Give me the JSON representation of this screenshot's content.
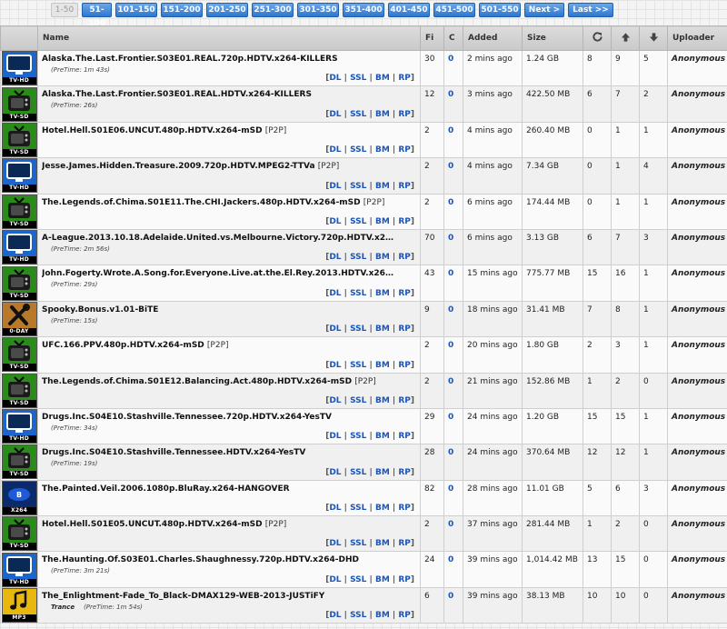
{
  "pager": {
    "current": "1-50",
    "links": [
      "51-100",
      "101-150",
      "151-200",
      "201-250",
      "251-300",
      "301-350",
      "351-400",
      "401-450",
      "451-500",
      "501-550"
    ],
    "next": "Next >",
    "last": "Last >>"
  },
  "columns": {
    "name": "Name",
    "files": "Fi",
    "comments": "C",
    "added": "Added",
    "size": "Size",
    "uploader": "Uploader"
  },
  "link_labels": {
    "dl": "DL",
    "ssl": "SSL",
    "bm": "BM",
    "rp": "RP"
  },
  "rows": [
    {
      "cat": "tvhd",
      "cat_label": "TV-HD",
      "name": "Alaska.The.Last.Frontier.S03E01.REAL.720p.HDTV.x264-KILLERS",
      "p2p": "",
      "pretime": "(PreTime: 1m 43s)",
      "genre": "",
      "files": "30",
      "comments": "0",
      "added": "2 mins ago",
      "size": "1.24 GB",
      "snatched": "8",
      "seeders": "9",
      "leechers": "5",
      "uploader": "Anonymous"
    },
    {
      "cat": "tvsd",
      "cat_label": "TV-SD",
      "name": "Alaska.The.Last.Frontier.S03E01.REAL.HDTV.x264-KILLERS",
      "p2p": "",
      "pretime": "(PreTime: 26s)",
      "genre": "",
      "files": "12",
      "comments": "0",
      "added": "3 mins ago",
      "size": "422.50 MB",
      "snatched": "6",
      "seeders": "7",
      "leechers": "2",
      "uploader": "Anonymous"
    },
    {
      "cat": "tvsd",
      "cat_label": "TV-SD",
      "name": "Hotel.Hell.S01E06.UNCUT.480p.HDTV.x264-mSD",
      "p2p": "[P2P]",
      "pretime": "",
      "genre": "",
      "files": "2",
      "comments": "0",
      "added": "4 mins ago",
      "size": "260.40 MB",
      "snatched": "0",
      "seeders": "1",
      "leechers": "1",
      "uploader": "Anonymous"
    },
    {
      "cat": "tvhd",
      "cat_label": "TV-HD",
      "name": "Jesse.James.Hidden.Treasure.2009.720p.HDTV.MPEG2-TTVa",
      "p2p": "[P2P]",
      "pretime": "",
      "genre": "",
      "files": "2",
      "comments": "0",
      "added": "4 mins ago",
      "size": "7.34 GB",
      "snatched": "0",
      "seeders": "1",
      "leechers": "4",
      "uploader": "Anonymous"
    },
    {
      "cat": "tvsd",
      "cat_label": "TV-SD",
      "name": "The.Legends.of.Chima.S01E11.The.CHI.Jackers.480p.HDTV.x264-mSD",
      "p2p": "[P2P]",
      "pretime": "",
      "genre": "",
      "files": "2",
      "comments": "0",
      "added": "6 mins ago",
      "size": "174.44 MB",
      "snatched": "0",
      "seeders": "1",
      "leechers": "1",
      "uploader": "Anonymous"
    },
    {
      "cat": "tvhd",
      "cat_label": "TV-HD",
      "name": "A-League.2013.10.18.Adelaide.United.vs.Melbourne.Victory.720p.HDTV.x264-...",
      "p2p": "",
      "pretime": "(PreTime: 2m 56s)",
      "genre": "",
      "files": "70",
      "comments": "0",
      "added": "6 mins ago",
      "size": "3.13 GB",
      "snatched": "6",
      "seeders": "7",
      "leechers": "3",
      "uploader": "Anonymous"
    },
    {
      "cat": "tvsd",
      "cat_label": "TV-SD",
      "name": "John.Fogerty.Wrote.A.Song.for.Everyone.Live.at.the.El.Rey.2013.HDTV.x264-2...",
      "p2p": "",
      "pretime": "(PreTime: 29s)",
      "genre": "",
      "files": "43",
      "comments": "0",
      "added": "15 mins ago",
      "size": "775.77 MB",
      "snatched": "15",
      "seeders": "16",
      "leechers": "1",
      "uploader": "Anonymous"
    },
    {
      "cat": "oday",
      "cat_label": "0-DAY",
      "name": "Spooky.Bonus.v1.01-BiTE",
      "p2p": "",
      "pretime": "(PreTime: 15s)",
      "genre": "",
      "files": "9",
      "comments": "0",
      "added": "18 mins ago",
      "size": "31.41 MB",
      "snatched": "7",
      "seeders": "8",
      "leechers": "1",
      "uploader": "Anonymous"
    },
    {
      "cat": "tvsd",
      "cat_label": "TV-SD",
      "name": "UFC.166.PPV.480p.HDTV.x264-mSD",
      "p2p": "[P2P]",
      "pretime": "",
      "genre": "",
      "files": "2",
      "comments": "0",
      "added": "20 mins ago",
      "size": "1.80 GB",
      "snatched": "2",
      "seeders": "3",
      "leechers": "1",
      "uploader": "Anonymous"
    },
    {
      "cat": "tvsd",
      "cat_label": "TV-SD",
      "name": "The.Legends.of.Chima.S01E12.Balancing.Act.480p.HDTV.x264-mSD",
      "p2p": "[P2P]",
      "pretime": "",
      "genre": "",
      "files": "2",
      "comments": "0",
      "added": "21 mins ago",
      "size": "152.86 MB",
      "snatched": "1",
      "seeders": "2",
      "leechers": "0",
      "uploader": "Anonymous"
    },
    {
      "cat": "tvhd",
      "cat_label": "TV-HD",
      "name": "Drugs.Inc.S04E10.Stashville.Tennessee.720p.HDTV.x264-YesTV",
      "p2p": "",
      "pretime": "(PreTime: 34s)",
      "genre": "",
      "files": "29",
      "comments": "0",
      "added": "24 mins ago",
      "size": "1.20 GB",
      "snatched": "15",
      "seeders": "15",
      "leechers": "1",
      "uploader": "Anonymous"
    },
    {
      "cat": "tvsd",
      "cat_label": "TV-SD",
      "name": "Drugs.Inc.S04E10.Stashville.Tennessee.HDTV.x264-YesTV",
      "p2p": "",
      "pretime": "(PreTime: 19s)",
      "genre": "",
      "files": "28",
      "comments": "0",
      "added": "24 mins ago",
      "size": "370.64 MB",
      "snatched": "12",
      "seeders": "12",
      "leechers": "1",
      "uploader": "Anonymous"
    },
    {
      "cat": "x264",
      "cat_label": "X264",
      "name": "The.Painted.Veil.2006.1080p.BluRay.x264-HANGOVER",
      "p2p": "",
      "pretime": "",
      "genre": "",
      "files": "82",
      "comments": "0",
      "added": "28 mins ago",
      "size": "11.01 GB",
      "snatched": "5",
      "seeders": "6",
      "leechers": "3",
      "uploader": "Anonymous"
    },
    {
      "cat": "tvsd",
      "cat_label": "TV-SD",
      "name": "Hotel.Hell.S01E05.UNCUT.480p.HDTV.x264-mSD",
      "p2p": "[P2P]",
      "pretime": "",
      "genre": "",
      "files": "2",
      "comments": "0",
      "added": "37 mins ago",
      "size": "281.44 MB",
      "snatched": "1",
      "seeders": "2",
      "leechers": "0",
      "uploader": "Anonymous"
    },
    {
      "cat": "tvhd",
      "cat_label": "TV-HD",
      "name": "The.Haunting.Of.S03E01.Charles.Shaughnessy.720p.HDTV.x264-DHD",
      "p2p": "",
      "pretime": "(PreTime: 3m 21s)",
      "genre": "",
      "files": "24",
      "comments": "0",
      "added": "39 mins ago",
      "size": "1,014.42 MB",
      "snatched": "13",
      "seeders": "15",
      "leechers": "0",
      "uploader": "Anonymous"
    },
    {
      "cat": "mp3",
      "cat_label": "MP3",
      "name": "The_Enlightment-Fade_To_Black-DMAX129-WEB-2013-JUSTiFY",
      "p2p": "",
      "pretime": "(PreTime: 1m 54s)",
      "genre": "Trance",
      "files": "6",
      "comments": "0",
      "added": "39 mins ago",
      "size": "38.13 MB",
      "snatched": "10",
      "seeders": "10",
      "leechers": "0",
      "uploader": "Anonymous"
    }
  ]
}
